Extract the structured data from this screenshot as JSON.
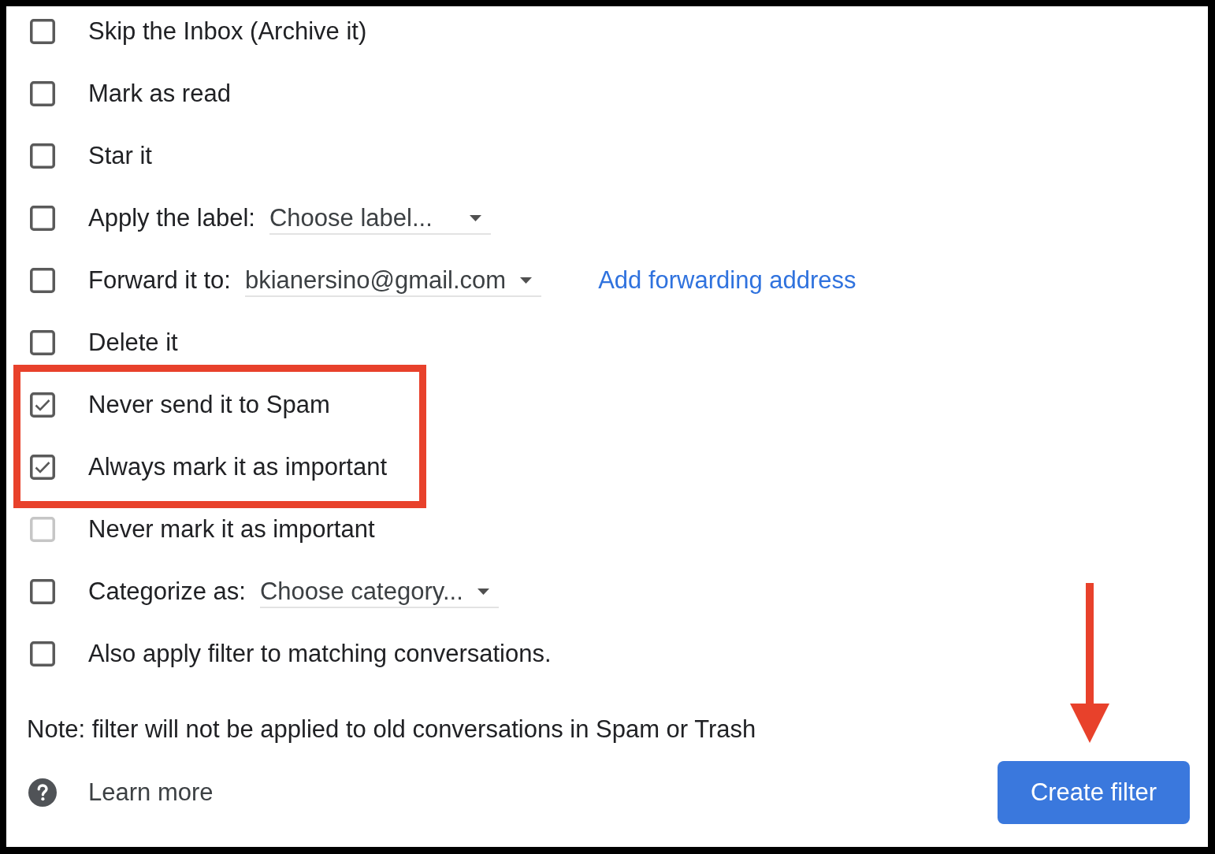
{
  "options": [
    {
      "label": "Skip the Inbox (Archive it)",
      "checked": false,
      "disabled": false,
      "highlighted": false
    },
    {
      "label": "Mark as read",
      "checked": false,
      "disabled": false,
      "highlighted": false
    },
    {
      "label": "Star it",
      "checked": false,
      "disabled": false,
      "highlighted": false
    },
    {
      "label": "Apply the label:",
      "dropdown": {
        "value": "Choose label..."
      },
      "checked": false,
      "disabled": false,
      "highlighted": false
    },
    {
      "label": "Forward it to:",
      "dropdown": {
        "value": "bkianersino@gmail.com"
      },
      "link": "Add forwarding address",
      "checked": false,
      "disabled": false,
      "highlighted": false
    },
    {
      "label": "Delete it",
      "checked": false,
      "disabled": false,
      "highlighted": false
    },
    {
      "label": "Never send it to Spam",
      "checked": true,
      "disabled": false,
      "highlighted": true
    },
    {
      "label": "Always mark it as important",
      "checked": true,
      "disabled": false,
      "highlighted": true
    },
    {
      "label": "Never mark it as important",
      "checked": false,
      "disabled": true,
      "highlighted": false
    },
    {
      "label": "Categorize as:",
      "dropdown": {
        "value": "Choose category..."
      },
      "checked": false,
      "disabled": false,
      "highlighted": false
    },
    {
      "label": "Also apply filter to matching conversations.",
      "checked": false,
      "disabled": false,
      "highlighted": false
    }
  ],
  "note": "Note: filter will not be applied to old conversations in Spam or Trash",
  "learn_more": "Learn more",
  "create_button": {
    "label": "Create filter",
    "pointed": true
  }
}
